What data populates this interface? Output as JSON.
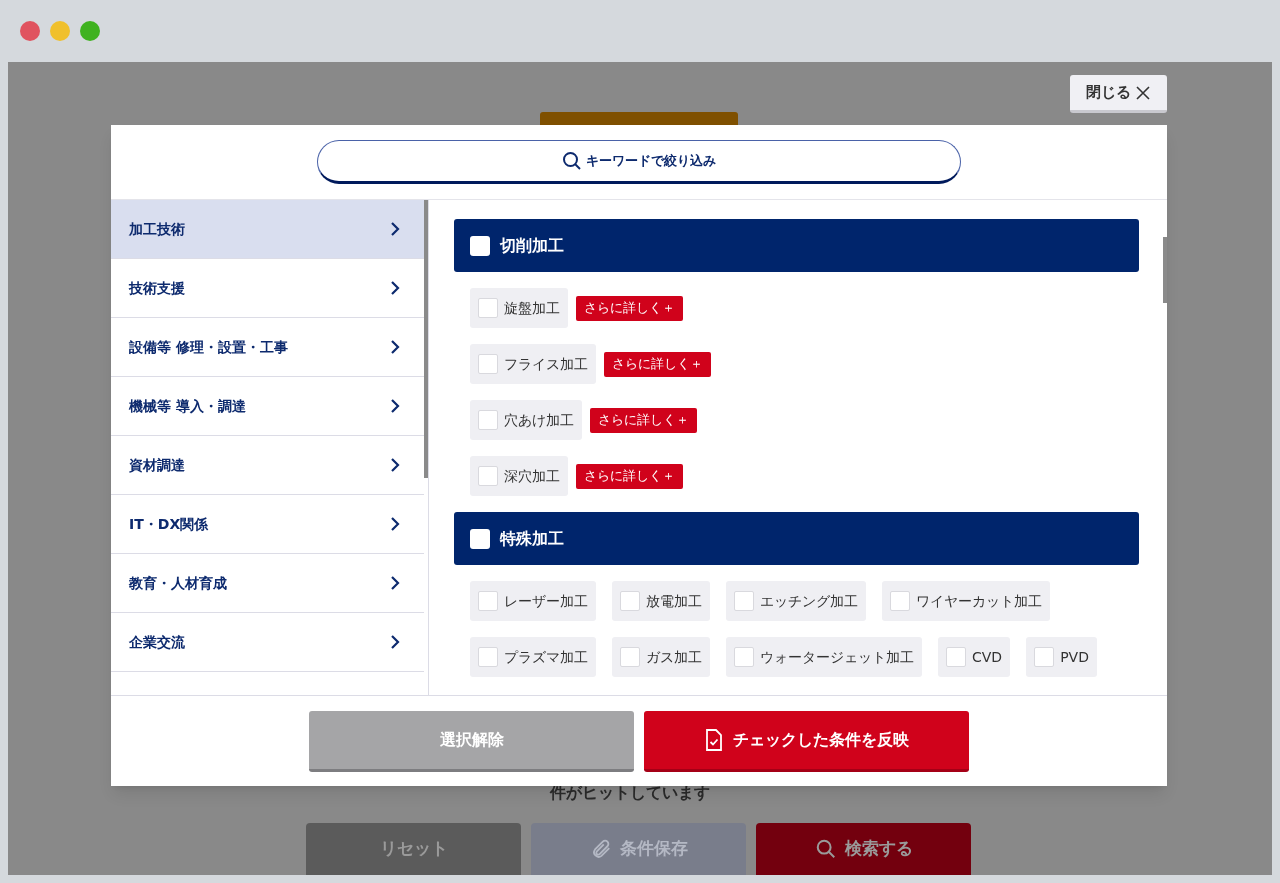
{
  "close_button": {
    "label": "閉じる"
  },
  "keyword_button": {
    "label": "キーワードで絞り込み"
  },
  "categories": [
    {
      "label": "加工技術",
      "selected": true
    },
    {
      "label": "技術支援",
      "selected": false
    },
    {
      "label": "設備等 修理・設置・工事",
      "selected": false
    },
    {
      "label": "機械等 導入・調達",
      "selected": false
    },
    {
      "label": "資材調達",
      "selected": false
    },
    {
      "label": "IT・DX関係",
      "selected": false
    },
    {
      "label": "教育・人材育成",
      "selected": false
    },
    {
      "label": "企業交流",
      "selected": false
    }
  ],
  "sections": [
    {
      "title": "切削加工",
      "checked": false,
      "items": [
        {
          "label": "旋盤加工",
          "checked": false,
          "detail": "さらに詳しく＋"
        },
        {
          "label": "フライス加工",
          "checked": false,
          "detail": "さらに詳しく＋"
        },
        {
          "label": "穴あけ加工",
          "checked": false,
          "detail": "さらに詳しく＋"
        },
        {
          "label": "深穴加工",
          "checked": false,
          "detail": "さらに詳しく＋"
        }
      ]
    },
    {
      "title": "特殊加工",
      "checked": false,
      "items": [
        {
          "label": "レーザー加工",
          "checked": false
        },
        {
          "label": "放電加工",
          "checked": false
        },
        {
          "label": "エッチング加工",
          "checked": false
        },
        {
          "label": "ワイヤーカット加工",
          "checked": false
        },
        {
          "label": "プラズマ加工",
          "checked": false
        },
        {
          "label": "ガス加工",
          "checked": false
        },
        {
          "label": "ウォータージェット加工",
          "checked": false
        },
        {
          "label": "CVD",
          "checked": false
        },
        {
          "label": "PVD",
          "checked": false
        }
      ]
    }
  ],
  "footer": {
    "clear_button": "選択解除",
    "apply_button": "チェックした条件を反映"
  },
  "background_page": {
    "hit_text": "件がヒットしています",
    "buttons": [
      {
        "label": "リセット",
        "kind": "reset"
      },
      {
        "label": "条件保存",
        "kind": "save"
      },
      {
        "label": "検索する",
        "kind": "search"
      }
    ]
  }
}
